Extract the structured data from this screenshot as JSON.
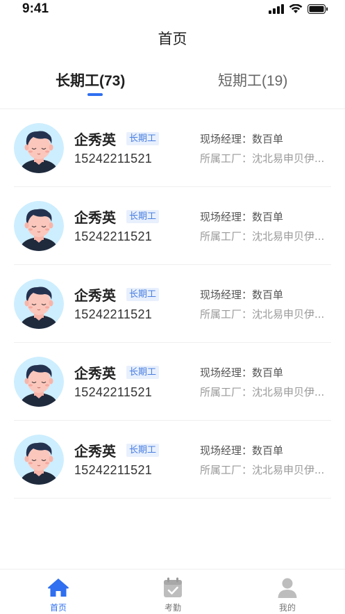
{
  "status_bar": {
    "time": "9:41"
  },
  "nav": {
    "title": "首页"
  },
  "tabs": [
    {
      "label": "长期工(73)",
      "active": true
    },
    {
      "label": "短期工(19)",
      "active": false
    }
  ],
  "colors": {
    "accent": "#2f6ff0",
    "badge_bg": "#e8f0fd",
    "badge_text": "#4a7fe0"
  },
  "workers": [
    {
      "name": "企秀英",
      "badge": "长期工",
      "phone": "15242211521",
      "manager_label": "现场经理：",
      "manager": "数百单",
      "factory_label": "所属工厂：",
      "factory": "沈北易申贝伊..."
    },
    {
      "name": "企秀英",
      "badge": "长期工",
      "phone": "15242211521",
      "manager_label": "现场经理：",
      "manager": "数百单",
      "factory_label": "所属工厂：",
      "factory": "沈北易申贝伊..."
    },
    {
      "name": "企秀英",
      "badge": "长期工",
      "phone": "15242211521",
      "manager_label": "现场经理：",
      "manager": "数百单",
      "factory_label": "所属工厂：",
      "factory": "沈北易申贝伊..."
    },
    {
      "name": "企秀英",
      "badge": "长期工",
      "phone": "15242211521",
      "manager_label": "现场经理：",
      "manager": "数百单",
      "factory_label": "所属工厂：",
      "factory": "沈北易申贝伊..."
    },
    {
      "name": "企秀英",
      "badge": "长期工",
      "phone": "15242211521",
      "manager_label": "现场经理：",
      "manager": "数百单",
      "factory_label": "所属工厂：",
      "factory": "沈北易申贝伊..."
    }
  ],
  "tabbar": [
    {
      "label": "首页",
      "icon": "home-icon",
      "active": true
    },
    {
      "label": "考勤",
      "icon": "calendar-check-icon",
      "active": false
    },
    {
      "label": "我的",
      "icon": "user-icon",
      "active": false
    }
  ]
}
